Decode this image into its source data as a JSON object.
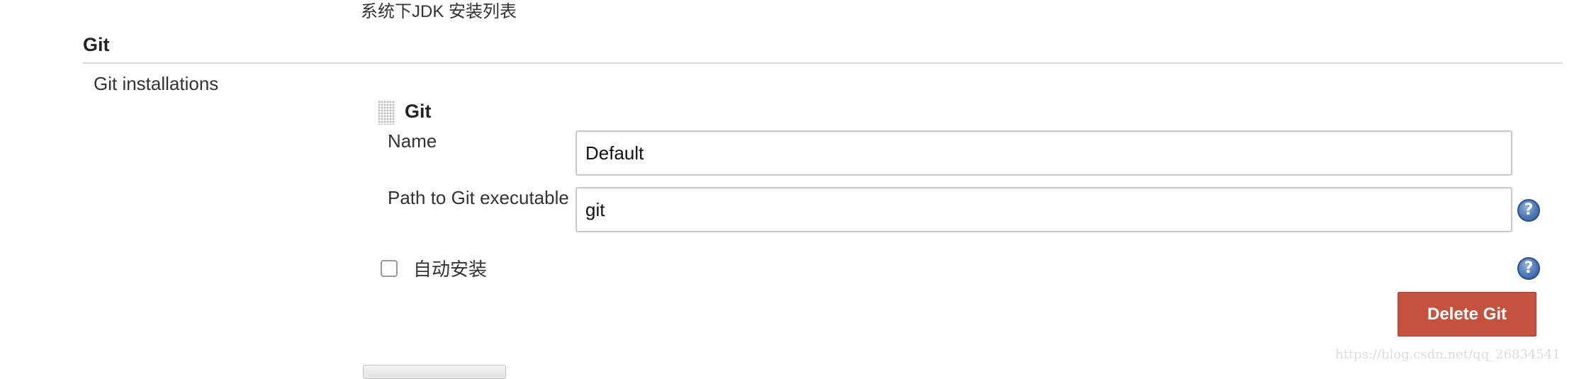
{
  "jdk_section": {
    "description": "系统下JDK 安装列表"
  },
  "git_section": {
    "title": "Git",
    "installations_label": "Git installations",
    "installation": {
      "title": "Git",
      "name_label": "Name",
      "name_value": "Default",
      "path_label": "Path to Git executable",
      "path_value": "git",
      "auto_install_label": "自动安装",
      "auto_install_checked": false,
      "delete_button_label": "Delete Git",
      "help_icon_glyph": "?"
    }
  },
  "watermark": "https://blog.csdn.net/qq_26834541",
  "colors": {
    "delete_button": "#c6513f",
    "help_icon": "#4d78b5",
    "divider": "#d9d9d9"
  },
  "icons": [
    "drag-handle-icon",
    "help-icon"
  ]
}
